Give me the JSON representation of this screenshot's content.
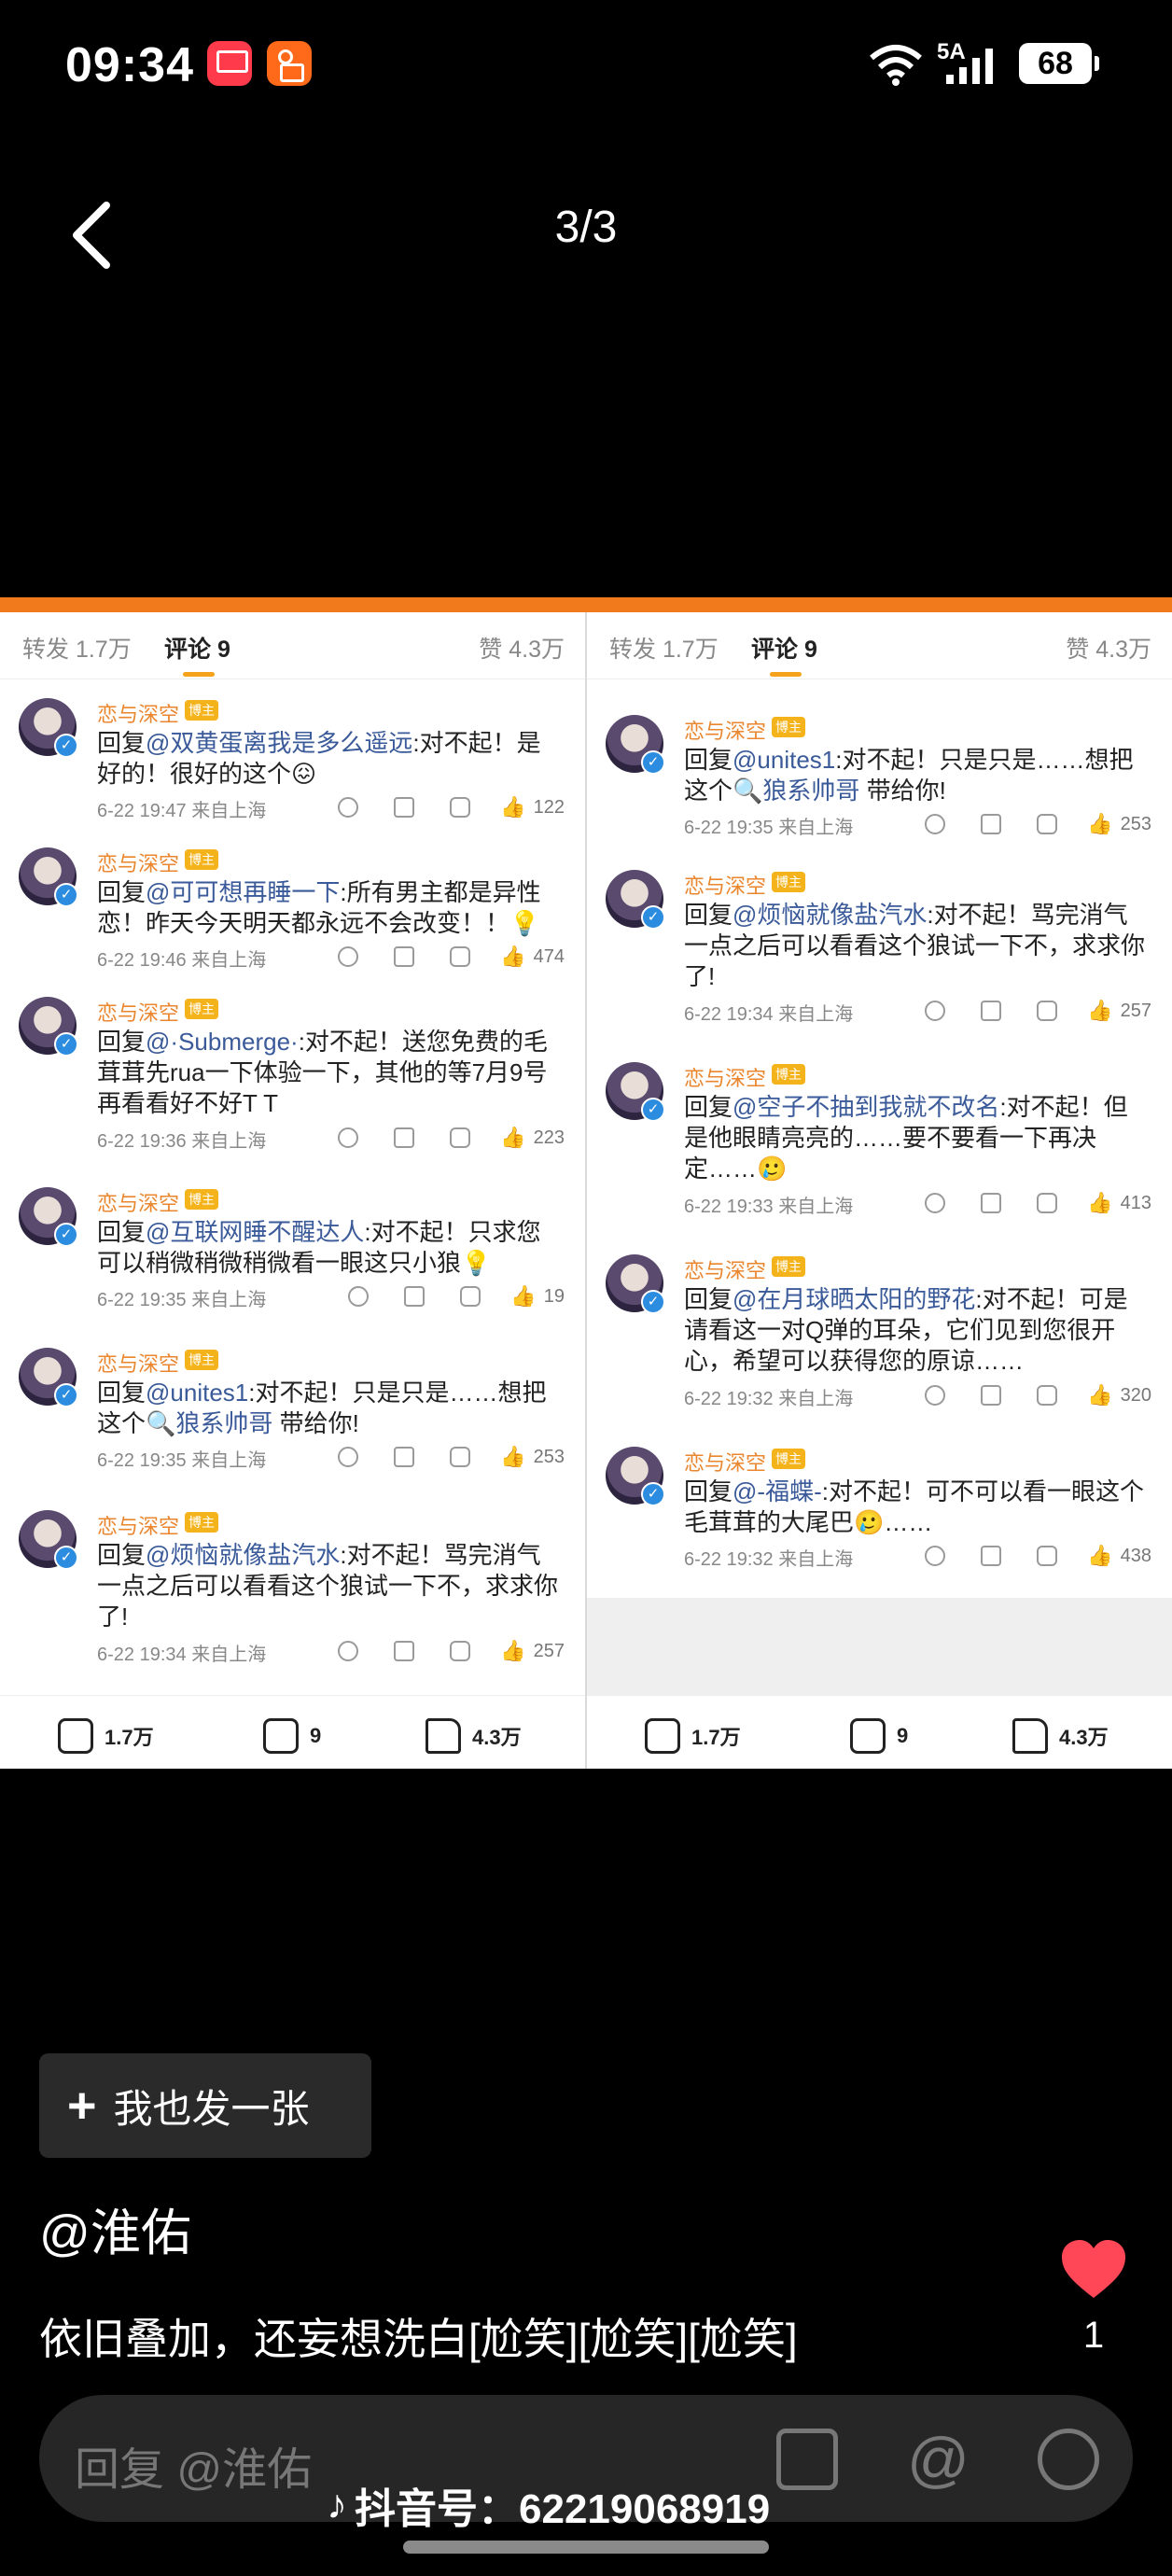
{
  "status": {
    "time": "09:34",
    "network": "5A",
    "battery": "68",
    "gallery_app_label": "App Gallery"
  },
  "nav": {
    "page_indicator": "3/3"
  },
  "screenshot": {
    "left": {
      "tabs": {
        "repost": "转发 1.7万",
        "comments": "评论 9",
        "likes": "赞 4.3万"
      },
      "comments": [
        {
          "name": "恋与深空",
          "badge": "博主",
          "prefix": "回复",
          "mention": "@双黄蛋离我是多么遥远",
          "text": ":对不起！是好的！很好的这个😖",
          "time": "6-22 19:47",
          "location": "来自上海",
          "likes": "122"
        },
        {
          "name": "恋与深空",
          "badge": "博主",
          "prefix": "回复",
          "mention": "@可可想再睡一下",
          "text": ":所有男主都是异性恋！昨天今天明天都永远不会改变！！💡",
          "time": "6-22 19:46",
          "location": "来自上海",
          "likes": "474"
        },
        {
          "name": "恋与深空",
          "badge": "博主",
          "prefix": "回复",
          "mention": "@·Submerge·",
          "text": ":对不起！送您免费的毛茸茸先rua一下体验一下，其他的等7月9号再看看好不好T T",
          "time": "6-22 19:36",
          "location": "来自上海",
          "likes": "223"
        },
        {
          "name": "恋与深空",
          "badge": "博主",
          "prefix": "回复",
          "mention": "@互联网睡不醒达人",
          "text": ":对不起！只求您可以稍微稍微稍微看一眼这只小狼💡",
          "time": "6-22 19:35",
          "location": "来自上海",
          "likes": "19"
        },
        {
          "name": "恋与深空",
          "badge": "博主",
          "prefix": "回复",
          "mention": "@unites1",
          "text": ":对不起！只是只是……想把这个",
          "link": "🔍狼系帅哥",
          "text2": " 带给你!",
          "time": "6-22 19:35",
          "location": "来自上海",
          "likes": "253"
        },
        {
          "name": "恋与深空",
          "badge": "博主",
          "prefix": "回复",
          "mention": "@烦恼就像盐汽水",
          "text": ":对不起！骂完消气一点之后可以看看这个狼试一下不，求求你了!",
          "time": "6-22 19:34",
          "location": "来自上海",
          "likes": "257"
        }
      ],
      "bottom": {
        "share": "1.7万",
        "comment": "9",
        "like": "4.3万"
      }
    },
    "right": {
      "tabs": {
        "repost": "转发 1.7万",
        "comments": "评论 9",
        "likes": "赞 4.3万"
      },
      "comments": [
        {
          "name": "恋与深空",
          "badge": "博主",
          "prefix": "回复",
          "mention": "@unites1",
          "text": ":对不起！只是只是……想把这个",
          "link": "🔍狼系帅哥",
          "text2": " 带给你!",
          "time": "6-22 19:35",
          "location": "来自上海",
          "likes": "253"
        },
        {
          "name": "恋与深空",
          "badge": "博主",
          "prefix": "回复",
          "mention": "@烦恼就像盐汽水",
          "text": ":对不起！骂完消气一点之后可以看看这个狼试一下不，求求你了!",
          "time": "6-22 19:34",
          "location": "来自上海",
          "likes": "257"
        },
        {
          "name": "恋与深空",
          "badge": "博主",
          "prefix": "回复",
          "mention": "@空子不抽到我就不改名",
          "text": ":对不起！但是他眼睛亮亮的……要不要看一下再决定……🥲",
          "time": "6-22 19:33",
          "location": "来自上海",
          "likes": "413"
        },
        {
          "name": "恋与深空",
          "badge": "博主",
          "prefix": "回复",
          "mention": "@在月球晒太阳的野花",
          "text": ":对不起！可是请看这一对Q弹的耳朵，它们见到您很开心，希望可以获得您的原谅……",
          "time": "6-22 19:32",
          "location": "来自上海",
          "likes": "320"
        },
        {
          "name": "恋与深空",
          "badge": "博主",
          "prefix": "回复",
          "mention": "@-福蝶-",
          "text": ":对不起！可不可以看一眼这个毛茸茸的大尾巴🥲……",
          "time": "6-22 19:32",
          "location": "来自上海",
          "likes": "438"
        }
      ],
      "bottom": {
        "share": "1.7万",
        "comment": "9",
        "like": "4.3万"
      }
    }
  },
  "post": {
    "post_button": "我也发一张",
    "author": "@淮佑",
    "caption": "依旧叠加，还妄想洗白[尬笑][尬笑][尬笑]",
    "like_count": "1"
  },
  "reply": {
    "placeholder": "回复 @淮佑"
  },
  "watermark": {
    "douyin_id": "抖音号：62219068919"
  },
  "colors": {
    "accent": "#f07a1c",
    "like": "#ff4757",
    "mention": "#3a5a99"
  }
}
